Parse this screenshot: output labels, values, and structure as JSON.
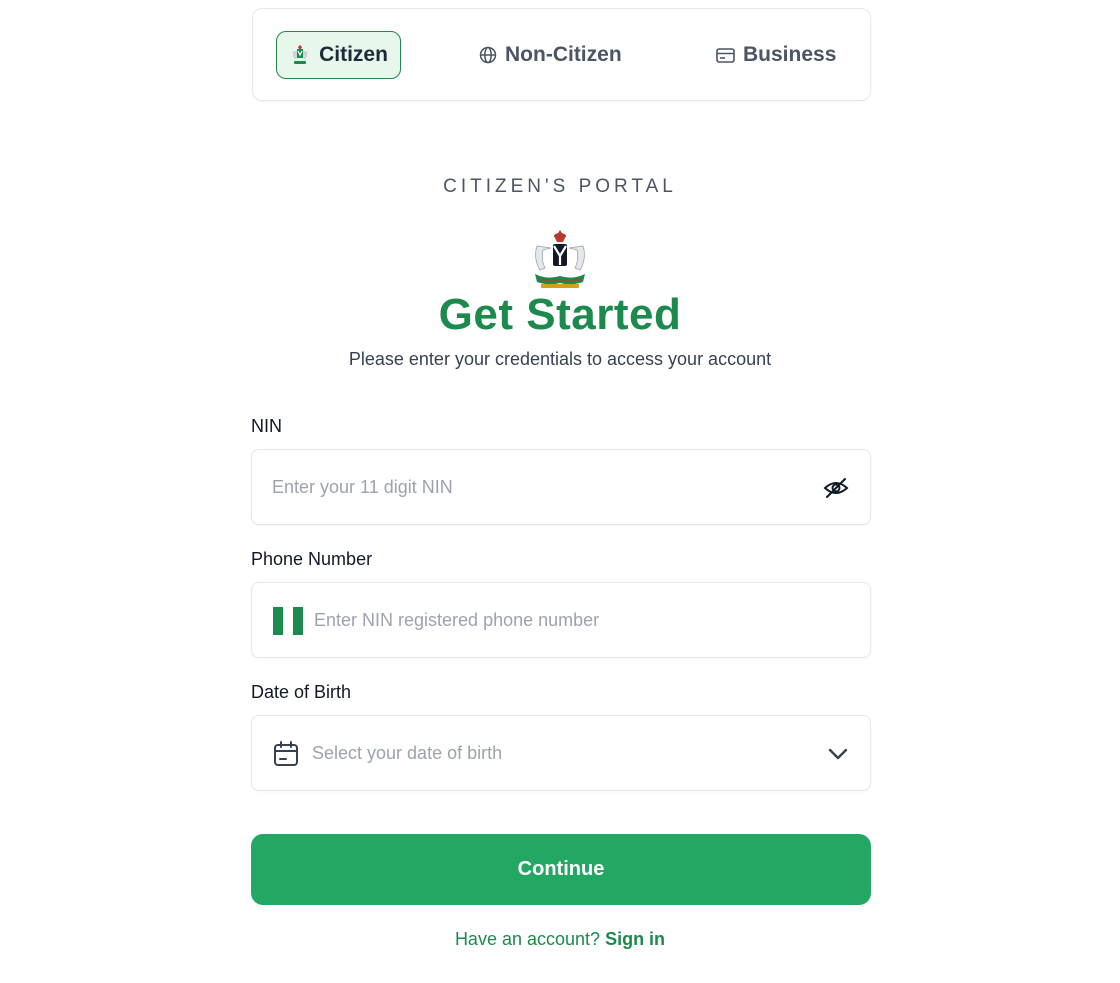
{
  "tabs": {
    "citizen": {
      "label": "Citizen",
      "icon": "coat-of-arms-icon",
      "active": true
    },
    "noncitizen": {
      "label": "Non-Citizen",
      "icon": "globe-icon"
    },
    "business": {
      "label": "Business",
      "icon": "business-card-icon"
    }
  },
  "portal_title": "CITIZEN'S PORTAL",
  "heading": "Get Started",
  "subheading": "Please enter your credentials to access your account",
  "form": {
    "nin": {
      "label": "NIN",
      "placeholder": "Enter your 11 digit NIN",
      "value": ""
    },
    "phone": {
      "label": "Phone Number",
      "placeholder": "Enter NIN registered phone number",
      "value": ""
    },
    "dob": {
      "label": "Date of Birth",
      "placeholder": "Select your date of birth",
      "value": ""
    }
  },
  "continue_label": "Continue",
  "signin": {
    "prompt": "Have an account?",
    "link": "Sign in"
  },
  "colors": {
    "brand_green": "#1b8a4c",
    "button_green": "#22a862",
    "active_tab_bg": "#e8f7ec"
  }
}
